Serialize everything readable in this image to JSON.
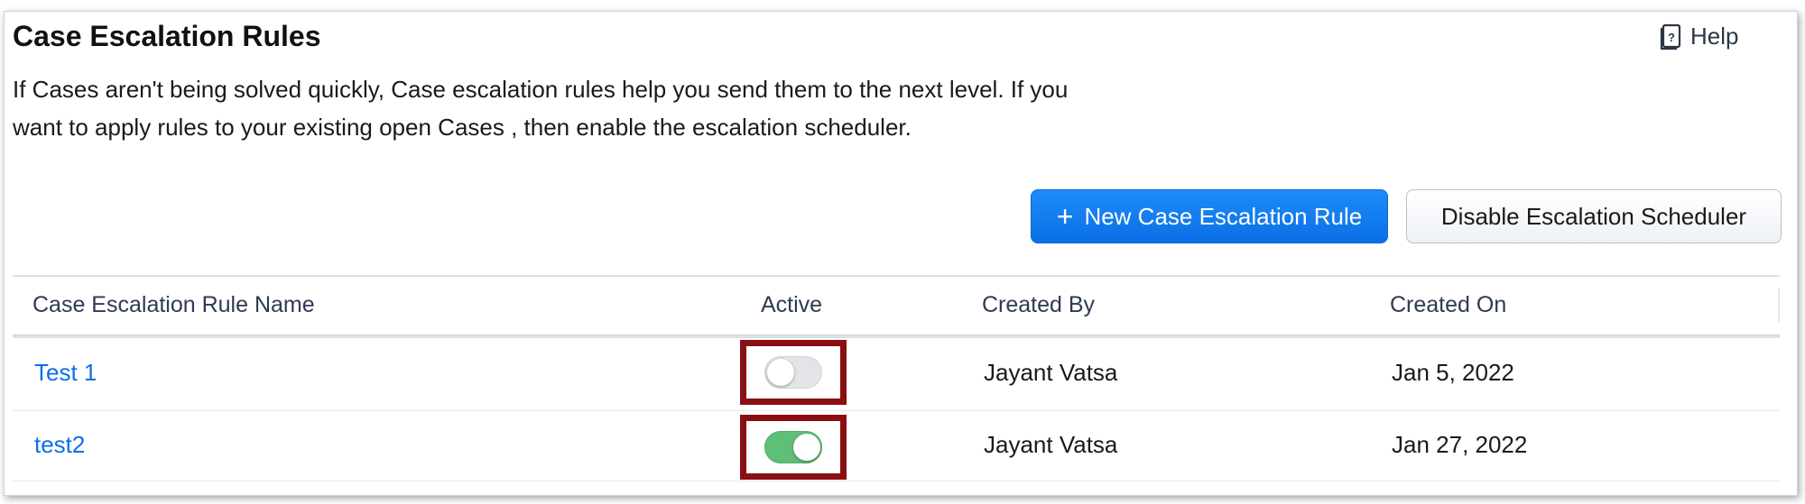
{
  "page": {
    "title": "Case Escalation Rules",
    "help_label": "Help",
    "description": "If Cases aren't being solved quickly, Case escalation rules help you send them to the next level. If you want to apply rules to your existing open Cases , then enable the escalation scheduler."
  },
  "actions": {
    "new_rule_label": "New Case Escalation Rule",
    "new_rule_icon": "plus-icon",
    "disable_scheduler_label": "Disable Escalation Scheduler"
  },
  "table": {
    "columns": [
      "Case Escalation Rule Name",
      "Active",
      "Created By",
      "Created On"
    ],
    "rows": [
      {
        "name": "Test 1",
        "active": false,
        "created_by": "Jayant Vatsa",
        "created_on": "Jan 5, 2022"
      },
      {
        "name": "test2",
        "active": true,
        "created_by": "Jayant Vatsa",
        "created_on": "Jan 27, 2022"
      }
    ]
  },
  "colors": {
    "primary_button": "#0b6fe6",
    "link": "#0b6fe6",
    "toggle_on": "#5fbf77",
    "toggle_off": "#e2e4e7",
    "highlight_box": "#8b0f12"
  }
}
